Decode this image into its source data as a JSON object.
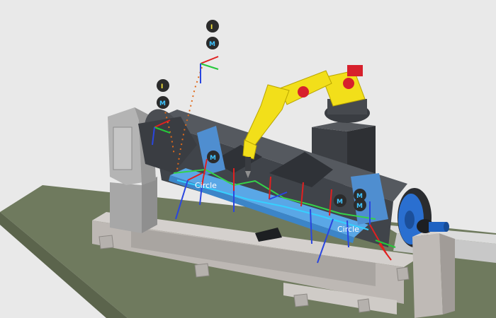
{
  "scene": {
    "background_color": "#e9e9e9",
    "floor_color": "#6f7a5e",
    "robot_color": "#f2df1a",
    "positioner_color": "#9a9a9a",
    "fixture_color": "#4a4d52",
    "part_color": "#5aa7e6",
    "faceplate_color": "#2a6fd0"
  },
  "markers": {
    "waypoint_i_letter": "I",
    "waypoint_m_letter": "M",
    "i_color": "#f5e43a",
    "m_color": "#3fc3ff"
  },
  "labels": {
    "circle_left": "Circle",
    "circle_right": "Circle"
  },
  "icons": {
    "waypoint_i": "waypoint-i-icon",
    "waypoint_m": "waypoint-m-icon",
    "frame_axes": "frame-axes-icon"
  }
}
